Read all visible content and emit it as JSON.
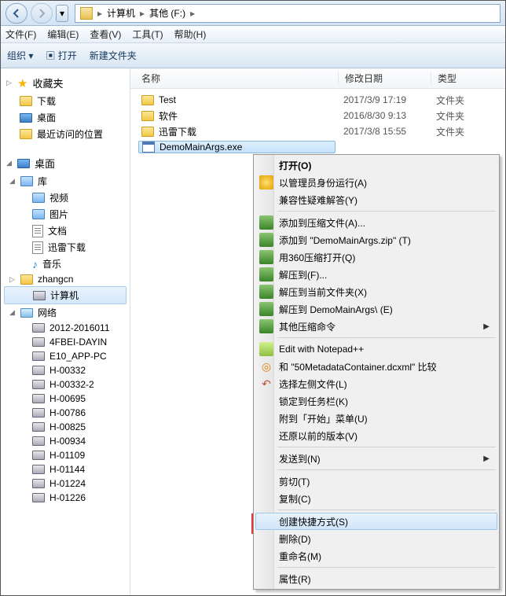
{
  "breadcrumb": {
    "root": "计算机",
    "drive": "其他 (F:)"
  },
  "menubar": [
    "文件(F)",
    "编辑(E)",
    "查看(V)",
    "工具(T)",
    "帮助(H)"
  ],
  "toolbar": {
    "org": "组织",
    "open": "打开",
    "newfolder": "新建文件夹"
  },
  "columns": {
    "name": "名称",
    "date": "修改日期",
    "type": "类型"
  },
  "sidebar": {
    "fav": {
      "title": "收藏夹",
      "items": [
        "下载",
        "桌面",
        "最近访问的位置"
      ]
    },
    "desk": {
      "title": "桌面",
      "lib": {
        "title": "库",
        "items": [
          "视频",
          "图片",
          "文档",
          "迅雷下载",
          "音乐"
        ]
      },
      "user": "zhangcn",
      "pc": "计算机",
      "net": {
        "title": "网络",
        "items": [
          "2012-2016011",
          "4FBEI-DAYIN",
          "E10_APP-PC",
          "H-00332",
          "H-00332-2",
          "H-00695",
          "H-00786",
          "H-00825",
          "H-00934",
          "H-01109",
          "H-01144",
          "H-01224",
          "H-01226"
        ]
      }
    }
  },
  "files": [
    {
      "name": "Test",
      "date": "2017/3/9 17:19",
      "type": "文件夹",
      "kind": "folder"
    },
    {
      "name": "软件",
      "date": "2016/8/30 9:13",
      "type": "文件夹",
      "kind": "folder"
    },
    {
      "name": "迅雷下载",
      "date": "2017/3/8 15:55",
      "type": "文件夹",
      "kind": "folder"
    },
    {
      "name": "DemoMainArgs.exe",
      "date": "",
      "type": "",
      "kind": "exe",
      "selected": true
    }
  ],
  "ctx": {
    "open": "打开(O)",
    "admin": "以管理员身份运行(A)",
    "compat": "兼容性疑难解答(Y)",
    "zipAdd": "添加到压缩文件(A)...",
    "zipTo": "添加到 \"DemoMainArgs.zip\" (T)",
    "zip360": "用360压缩打开(Q)",
    "unzip": "解压到(F)...",
    "unzipHere": "解压到当前文件夹(X)",
    "unzipTo": "解压到 DemoMainArgs\\ (E)",
    "zipOther": "其他压缩命令",
    "notepad": "Edit with Notepad++",
    "compare": "和 \"50MetadataContainer.dcxml\" 比较",
    "selLeft": "选择左侧文件(L)",
    "pin": "锁定到任务栏(K)",
    "pinStart": "附到「开始」菜单(U)",
    "restore": "还原以前的版本(V)",
    "sendto": "发送到(N)",
    "cut": "剪切(T)",
    "copy": "复制(C)",
    "shortcut": "创建快捷方式(S)",
    "delete": "删除(D)",
    "rename": "重命名(M)",
    "props": "属性(R)"
  }
}
